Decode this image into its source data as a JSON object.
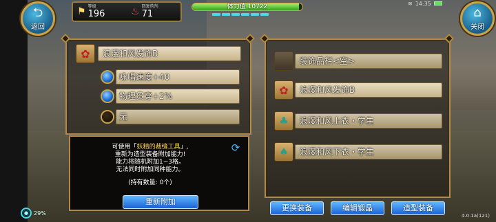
{
  "hud": {
    "back_label": "返回",
    "close_label": "关闭",
    "level_label": "等级",
    "level_value": "196",
    "potion_label": "回复药剂",
    "potion_value": "71",
    "hp_text": "体力值 10722",
    "hp_fill_fraction": 0.97,
    "clock": "14:35",
    "back_icon": "return-arrow-icon",
    "close_icon": "home-icon"
  },
  "left_panel": {
    "item_name": "浪漫和风发饰B",
    "abilities": [
      {
        "text": "咏唱速度+40",
        "orb": "blue"
      },
      {
        "text": "物理贯穿+2%",
        "orb": "blue"
      },
      {
        "text": "无",
        "orb": "empty"
      }
    ]
  },
  "info_box": {
    "line1_prefix": "可使用「",
    "line1_highlight": "妖精的裁缝工具",
    "line1_suffix": "」,",
    "line2": "重新为造型装备附加能力!",
    "line3": "能力将随机附加1~3格。",
    "line4": "无法同时附加同种能力。",
    "owned": "(持有数量: 0个)",
    "reattach_button": "重新附加"
  },
  "right_panel": {
    "slots": [
      {
        "label": "装饰品栏<空>",
        "icon": "empty-slot-icon",
        "active": false
      },
      {
        "label": "浪漫和风发饰B",
        "icon": "hair-ornament-icon",
        "active": true
      },
      {
        "label": "浪漫和风上衣・学生",
        "icon": "top-outfit-icon",
        "active": false
      },
      {
        "label": "浪漫和风下衣・学生",
        "icon": "bottom-outfit-icon",
        "active": false
      }
    ]
  },
  "bottom_bar": {
    "change_equip": "更换装备",
    "edit_set": "编辑锻晶",
    "style_equip": "造型装备",
    "exp_percent": "29%",
    "version": "4.0.1a(121)"
  },
  "colors": {
    "accent_gold": "#b08a48",
    "button_blue": "#1a62d6",
    "highlight_yellow": "#ffd84a"
  }
}
